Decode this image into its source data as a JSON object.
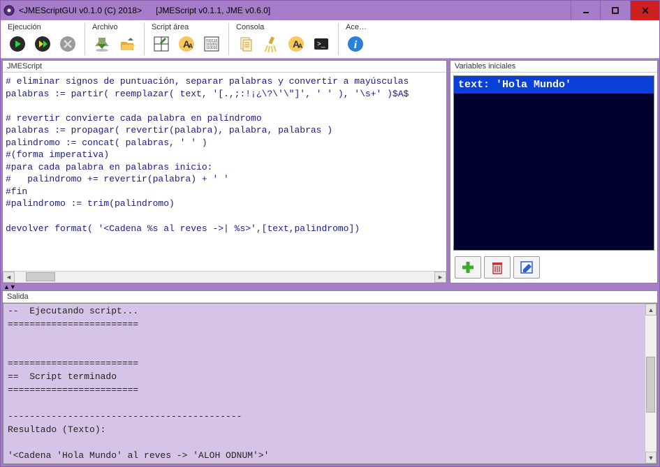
{
  "titlebar": {
    "primary": "<JMEScriptGUI v0.1.0  (C) 2018>",
    "secondary": "[JMEScript v0.1.1, JME v0.6.0]"
  },
  "toolbar": {
    "groups": [
      {
        "label": "Ejecución",
        "buttons": [
          "run",
          "run-alt",
          "stop"
        ]
      },
      {
        "label": "Archivo",
        "buttons": [
          "save",
          "open"
        ]
      },
      {
        "label": "Script área",
        "buttons": [
          "grid",
          "font-size",
          "binary"
        ]
      },
      {
        "label": "Consola",
        "buttons": [
          "copy",
          "clear",
          "font-console",
          "terminal"
        ]
      },
      {
        "label": "Ace…",
        "buttons": [
          "info"
        ]
      }
    ]
  },
  "panels": {
    "script_title": "JMEScript",
    "vars_title": "Variables iniciales",
    "output_title": "Salida"
  },
  "script_code": "# eliminar signos de puntuación, separar palabras y convertir a mayúsculas\npalabras := partir( reemplazar( text, '[.,;:!¡¿\\?\\'\\\"]', ' ' ), '\\s+' )$A$\n\n# revertir convierte cada palabra en palíndromo\npalabras := propagar( revertir(palabra), palabra, palabras )\npalindromo := concat( palabras, ' ' )\n#(forma imperativa)\n#para cada palabra en palabras inicio:\n#   palindromo += revertir(palabra) + ' '\n#fin\n#palindromo := trim(palindromo)\n\ndevolver format( '<Cadena %s al reves ->| %s>',[text,palindromo])",
  "variables": {
    "selected": "text: 'Hola Mundo'"
  },
  "output_text": "--  Ejecutando script...\n========================\n\n\n========================\n==  Script terminado\n========================\n\n-------------------------------------------\nResultado (Texto):\n\n'<Cadena 'Hola Mundo' al reves -> 'ALOH ODNUM'>'\n-------------------------------------------",
  "splitter_glyph": "▲▼",
  "colors": {
    "frame": "#a77cc8",
    "code_text": "#1a1a8a",
    "vars_bg": "#000030",
    "vars_sel": "#0a3fd8",
    "output_bg": "#d6c4e8",
    "close_btn": "#d01f1f"
  }
}
